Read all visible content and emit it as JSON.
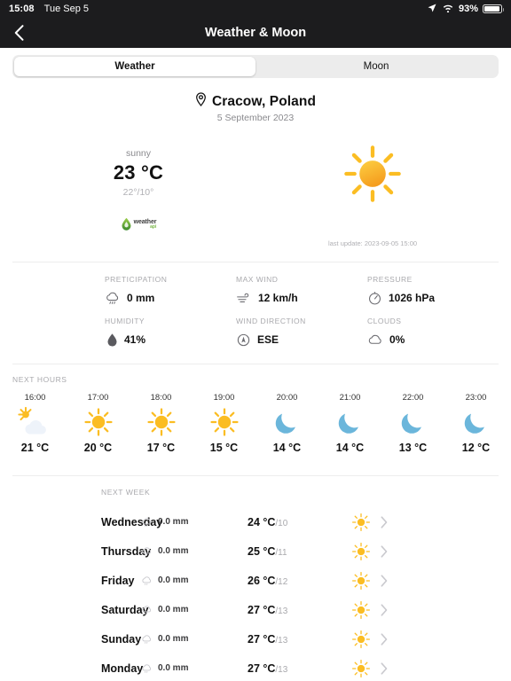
{
  "statusbar": {
    "time": "15:08",
    "date": "Tue Sep 5",
    "battery_percent": "93%",
    "icons": [
      "location-arrow-icon",
      "wifi-icon",
      "battery-icon"
    ]
  },
  "navbar": {
    "back_icon": "chevron-left-icon",
    "title": "Weather & Moon"
  },
  "tabs": {
    "items": [
      {
        "label": "Weather",
        "active": true
      },
      {
        "label": "Moon",
        "active": false
      }
    ]
  },
  "location": {
    "pin_icon": "location-pin-icon",
    "name": "Cracow, Poland",
    "date": "5 September 2023"
  },
  "current": {
    "condition": "sunny",
    "temperature": "23 °C",
    "range": "22°/10°",
    "icon": "sun-icon",
    "brand_name": "weather",
    "brand_sub": "api",
    "last_update": "last update: 2023-09-05 15:00"
  },
  "stats": {
    "row1": [
      {
        "label": "PRETICIPATION",
        "value": "0 mm",
        "icon": "drizzle-cloud-icon"
      },
      {
        "label": "MAX WIND",
        "value": "12 km/h",
        "icon": "wind-icon"
      },
      {
        "label": "PRESSURE",
        "value": "1026 hPa",
        "icon": "gauge-icon"
      }
    ],
    "row2": [
      {
        "label": "HUMIDITY",
        "value": "41%",
        "icon": "water-drop-icon"
      },
      {
        "label": "WIND DIRECTION",
        "value": "ESE",
        "icon": "compass-icon"
      },
      {
        "label": "CLOUDS",
        "value": "0%",
        "icon": "cloud-icon"
      }
    ]
  },
  "next_hours": {
    "label": "NEXT HOURS",
    "items": [
      {
        "time": "16:00",
        "temp": "21 °C",
        "icon": "sun-behind-cloud-icon"
      },
      {
        "time": "17:00",
        "temp": "20 °C",
        "icon": "sun-icon"
      },
      {
        "time": "18:00",
        "temp": "17 °C",
        "icon": "sun-icon"
      },
      {
        "time": "19:00",
        "temp": "15 °C",
        "icon": "sun-icon"
      },
      {
        "time": "20:00",
        "temp": "14 °C",
        "icon": "moon-icon"
      },
      {
        "time": "21:00",
        "temp": "14 °C",
        "icon": "moon-icon"
      },
      {
        "time": "22:00",
        "temp": "13 °C",
        "icon": "moon-icon"
      },
      {
        "time": "23:00",
        "temp": "12 °C",
        "icon": "moon-icon"
      }
    ]
  },
  "next_week": {
    "label": "NEXT WEEK",
    "items": [
      {
        "day": "Wednesday",
        "rain": "0.0 mm",
        "high": "24 °C",
        "low": "/10",
        "icon": "sun-icon"
      },
      {
        "day": "Thursday",
        "rain": "0.0 mm",
        "high": "25 °C",
        "low": "/11",
        "icon": "sun-icon"
      },
      {
        "day": "Friday",
        "rain": "0.0 mm",
        "high": "26 °C",
        "low": "/12",
        "icon": "sun-icon"
      },
      {
        "day": "Saturday",
        "rain": "0.0 mm",
        "high": "27 °C",
        "low": "/13",
        "icon": "sun-icon"
      },
      {
        "day": "Sunday",
        "rain": "0.0 mm",
        "high": "27 °C",
        "low": "/13",
        "icon": "sun-icon"
      },
      {
        "day": "Monday",
        "rain": "0.0 mm",
        "high": "27 °C",
        "low": "/13",
        "icon": "sun-icon"
      }
    ]
  },
  "colors": {
    "navbar_bg": "#1c1c1e",
    "sun_yellow": "#fcc02e",
    "sun_orange": "#f5a623",
    "moon_blue": "#6bb6db",
    "text_primary": "#111111",
    "text_muted": "#a9a9ad",
    "segment_track": "#ececec"
  }
}
